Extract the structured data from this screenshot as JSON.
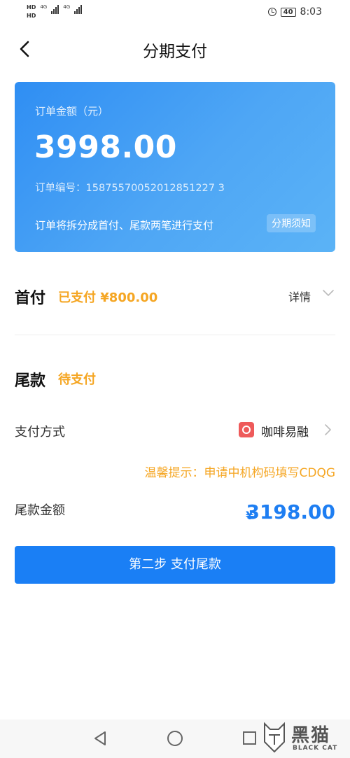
{
  "status_bar": {
    "hd1": "HD",
    "hd2": "HD",
    "net1": "4G",
    "net2": "4G",
    "battery": "40",
    "time": "8:03"
  },
  "nav": {
    "title": "分期支付",
    "back_icon": "chevron-left-icon"
  },
  "order_card": {
    "amount_label": "订单金额（元）",
    "amount": "3998.00",
    "order_no": "订单编号：15875570052012851227 3",
    "split_note": "订单将拆分成首付、尾款两笔进行支付",
    "notice_label": "分期须知",
    "gradient": [
      "#2f8ef3",
      "#5bb3f6"
    ]
  },
  "down_payment": {
    "title": "首付",
    "status": "已支付 ¥800.00",
    "detail_label": "详情"
  },
  "final_payment": {
    "title": "尾款",
    "status": "待支付",
    "method_label": "支付方式",
    "method_name": "咖啡易融",
    "tip": "温馨提示：申请中机构码填写CDQG",
    "amount_label": "尾款金额",
    "currency": "¥",
    "amount": "3198.00"
  },
  "action": {
    "button_label": "第二步  支付尾款"
  },
  "watermark": {
    "cn": "黑猫",
    "en": "BLACK CAT"
  },
  "colors": {
    "primary": "#1a7ff5",
    "accent": "#f5a623"
  }
}
